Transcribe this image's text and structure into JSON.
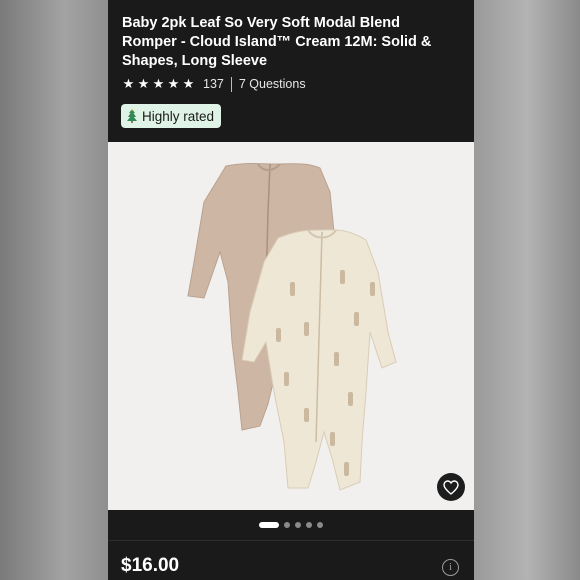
{
  "product": {
    "title": "Baby 2pk Leaf So Very Soft Modal Blend Romper - Cloud Island™ Cream 12M: Solid & Shapes, Long Sleeve",
    "rating_stars": 5,
    "review_count": "137",
    "questions": "7 Questions",
    "badge_label": "Highly rated",
    "price": "$16.00"
  },
  "carousel": {
    "total": 5,
    "active_index": 0
  },
  "icons": {
    "badge": "tree-icon",
    "favorite": "heart-icon",
    "info": "info-icon"
  },
  "colors": {
    "background": "#1a1a1a",
    "badge_bg": "#dff3e6",
    "image_bg": "#f2f0ee"
  }
}
